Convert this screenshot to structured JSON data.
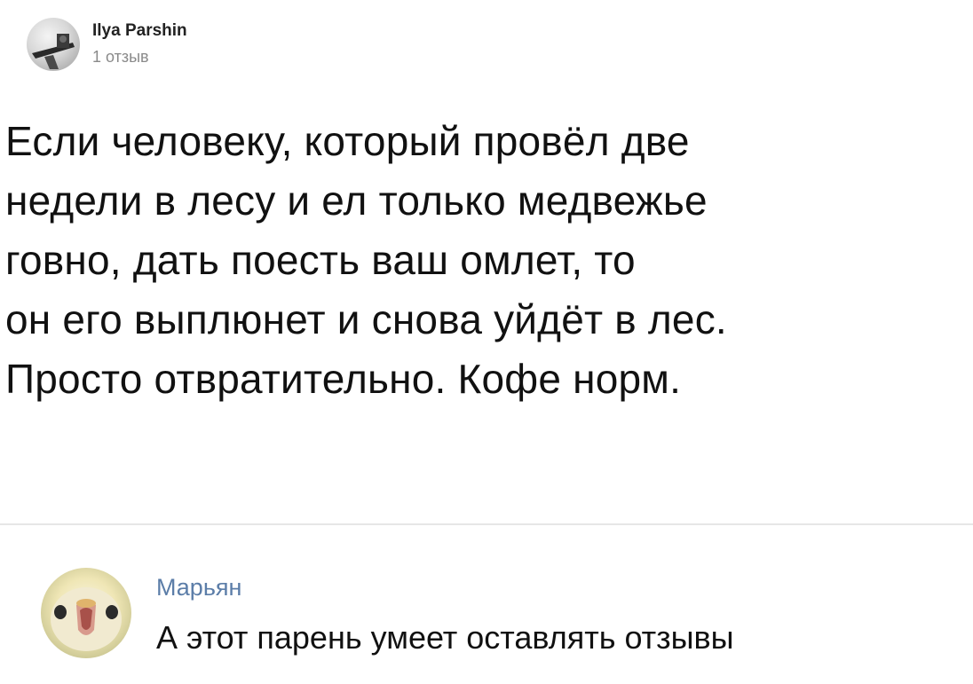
{
  "review": {
    "author": {
      "name": "Ilya Parshin",
      "review_count": "1 отзыв",
      "avatar_icon": "user-photo-icon"
    },
    "text_lines": [
      "Если человеку, который провёл две",
      "недели в лесу и ел только медвежье",
      "говно, дать поесть ваш омлет, то",
      "он его выплюнет и снова уйдёт в лес.",
      "Просто отвратительно. Кофе норм."
    ]
  },
  "comment": {
    "author": {
      "name": "Марьян",
      "avatar_icon": "bird-photo-icon"
    },
    "text": "А этот парень умеет оставлять отзывы"
  },
  "colors": {
    "background": "#ffffff",
    "text": "#111111",
    "muted": "#8a8a8a",
    "link": "#5b7da8",
    "divider": "#e6e6e6"
  }
}
